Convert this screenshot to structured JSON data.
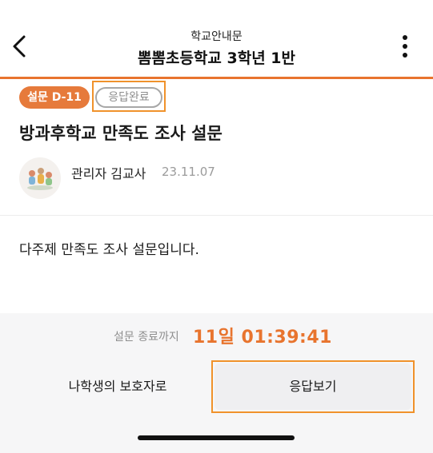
{
  "header": {
    "subtitle": "학교안내문",
    "title": "뽐뽐초등학교 3학년 1반",
    "back_icon": "chevron-left-icon",
    "more_icon": "more-vertical-icon"
  },
  "survey": {
    "dday_badge": "설문 D-11",
    "status_badge": "응답완료",
    "title": "방과후학교 만족도 조사 설문"
  },
  "author": {
    "name": "관리자 김교사",
    "date": "23.11.07"
  },
  "body": {
    "text": "다주제 만족도 조사 설문입니다."
  },
  "footer": {
    "deadline_label": "설문 종료까지",
    "deadline_value": "11일 01:39:41",
    "guardian_button": "나학생의 보호자로",
    "view_button": "응답보기"
  },
  "colors": {
    "accent": "#e8742e",
    "highlight": "#f0922b"
  }
}
